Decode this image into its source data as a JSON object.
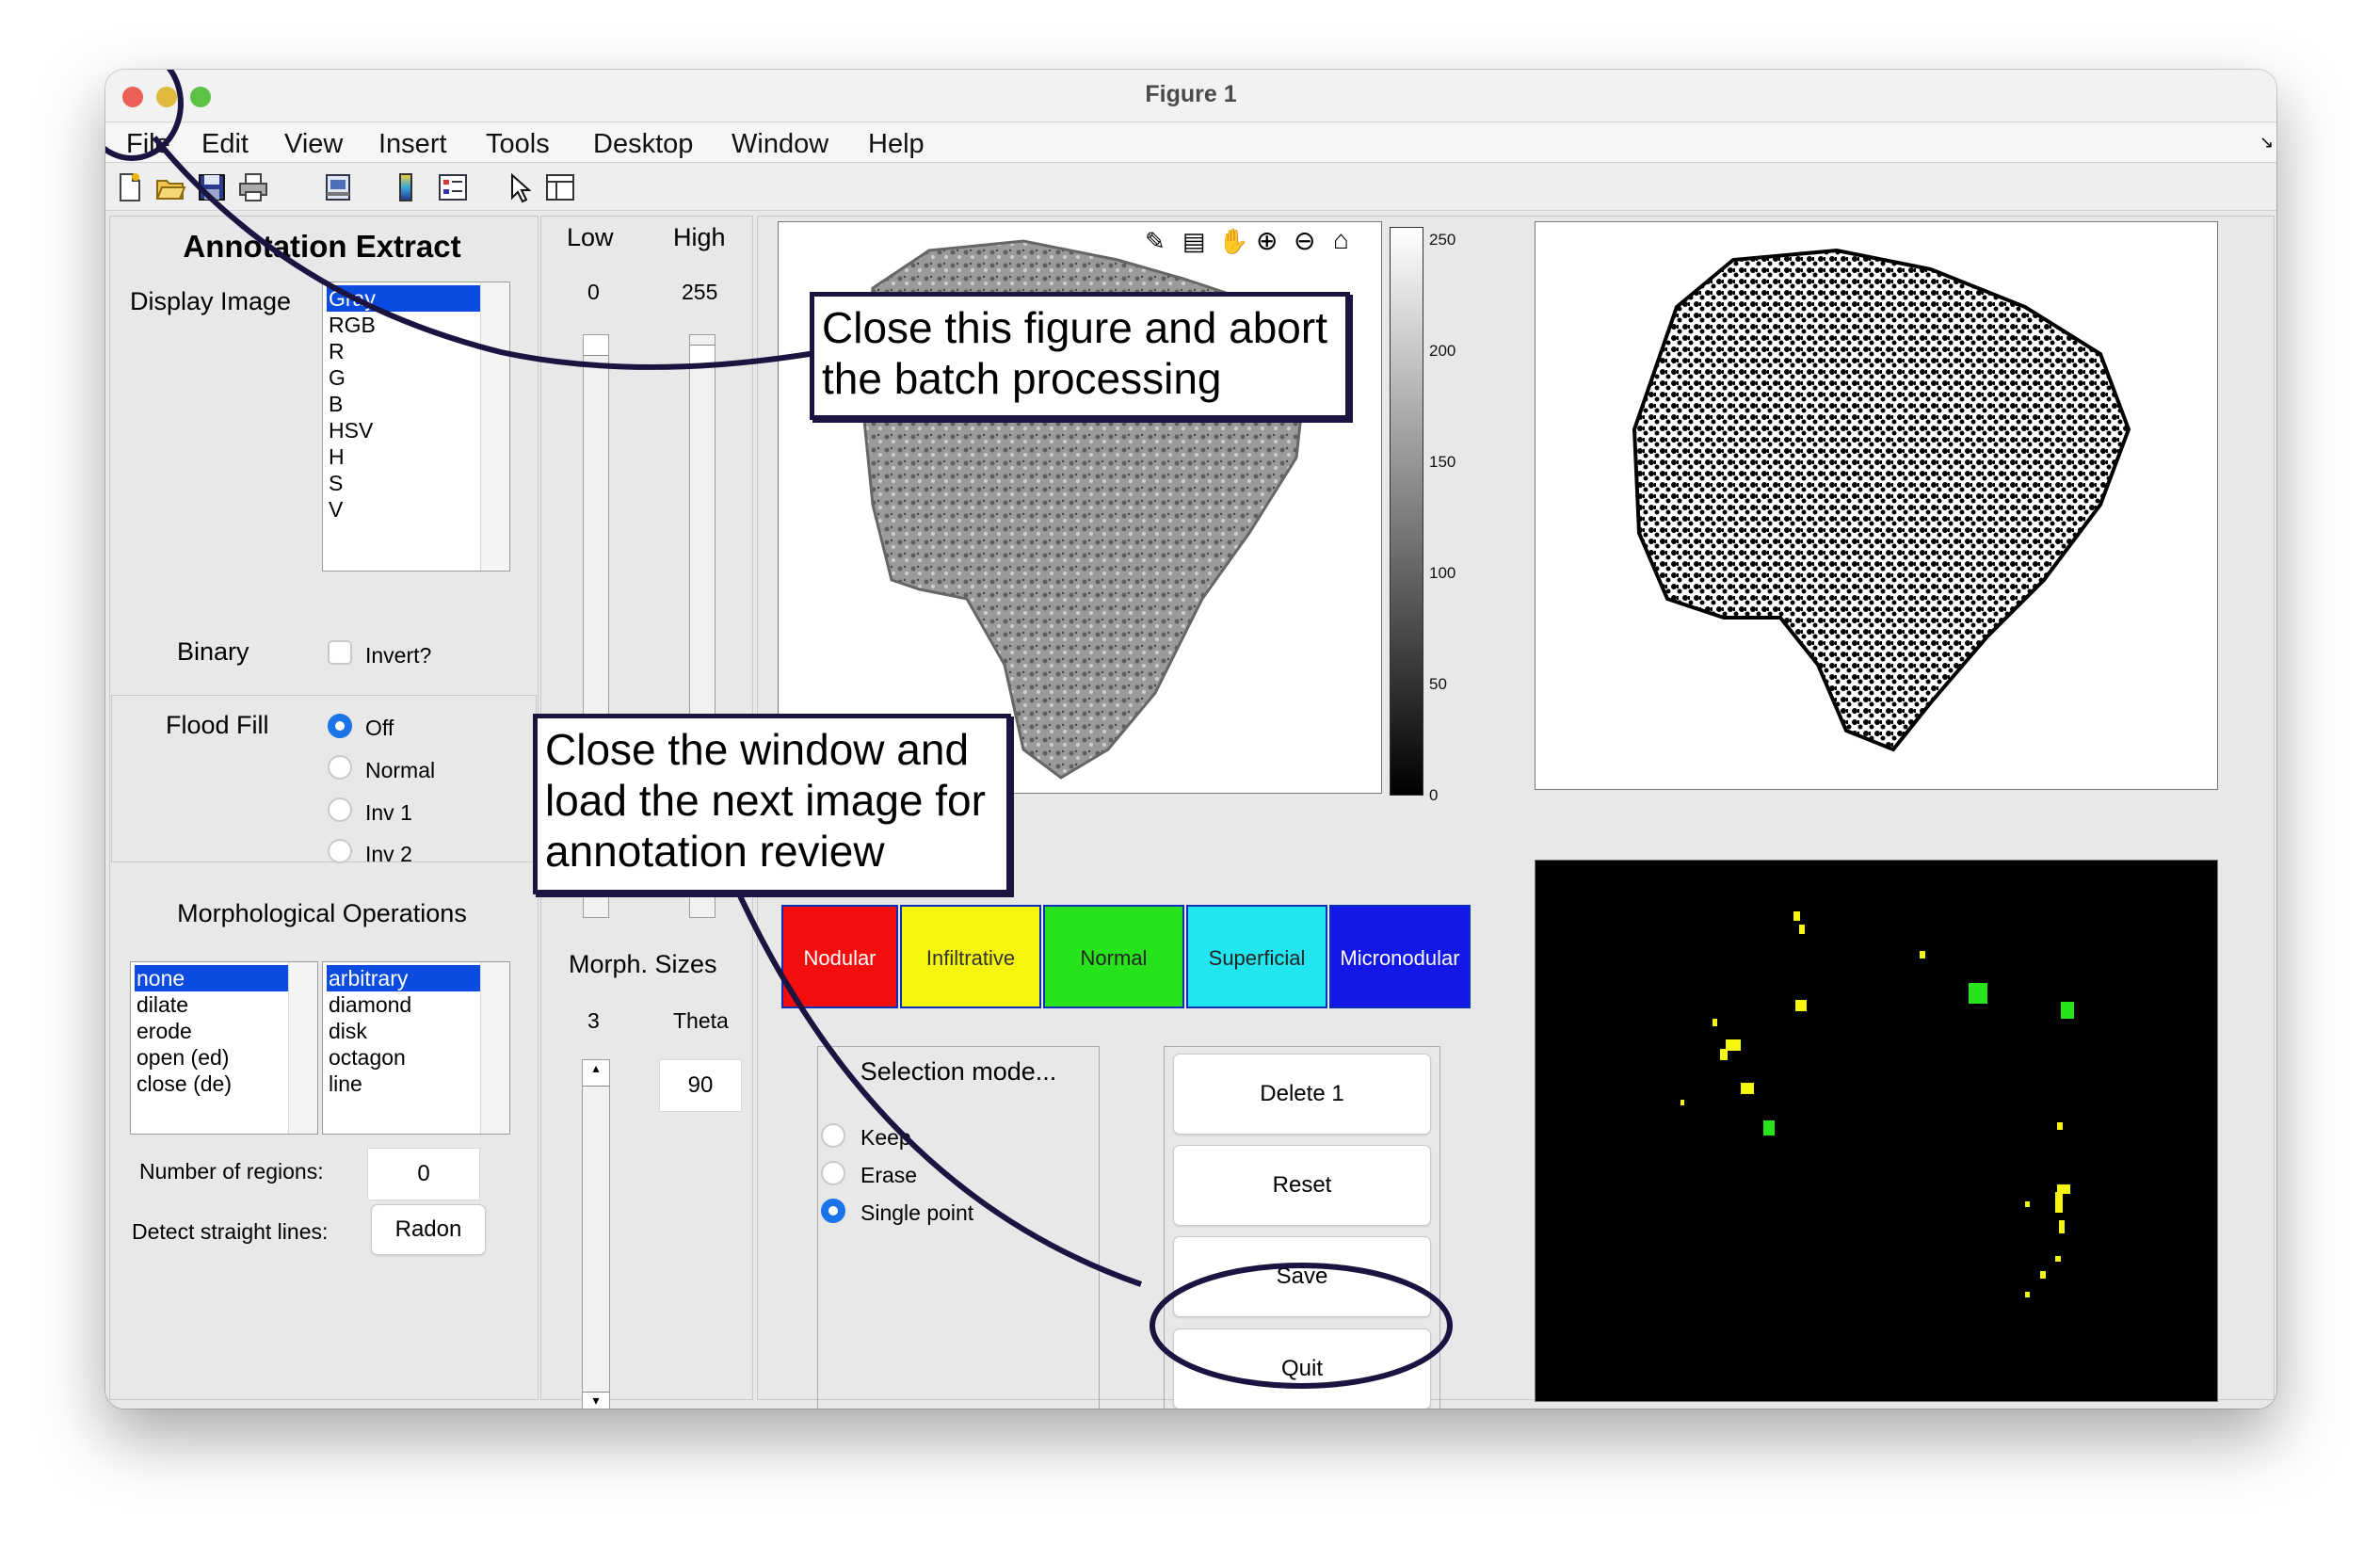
{
  "window": {
    "title": "Figure 1",
    "traffic_lights": {
      "close": "#ec5f57",
      "minimize": "#e0b93e",
      "maximize": "#5cc147"
    }
  },
  "menu": [
    "File",
    "Edit",
    "View",
    "Insert",
    "Tools",
    "Desktop",
    "Window",
    "Help"
  ],
  "toolbar": [
    "new-figure-icon",
    "open-file-icon",
    "save-icon",
    "print-icon",
    "print-preview-icon",
    "colorbar-icon",
    "legend-icon",
    "pointer-icon",
    "property-inspector-icon"
  ],
  "left_panel": {
    "title": "Annotation Extract",
    "display_image_label": "Display Image",
    "display_image_options": [
      "Gray",
      "RGB",
      "R",
      "G",
      "B",
      "HSV",
      "H",
      "S",
      "V"
    ],
    "display_image_selected": "Gray",
    "binary_label": "Binary",
    "invert_label": "Invert?",
    "flood_fill_label": "Flood Fill",
    "flood_fill_options": [
      "Off",
      "Normal",
      "Inv 1",
      "Inv 2"
    ],
    "flood_fill_selected": "Off",
    "morph_title": "Morphological Operations",
    "morph_ops": [
      "none",
      "dilate",
      "erode",
      "open (ed)",
      "close (de)"
    ],
    "morph_ops_selected": "none",
    "morph_shapes": [
      "arbitrary",
      "diamond",
      "disk",
      "octagon",
      "line"
    ],
    "morph_shapes_selected": "arbitrary",
    "num_regions_label": "Number of regions:",
    "num_regions_value": "0",
    "detect_lines_label": "Detect straight lines:",
    "radon_label": "Radon"
  },
  "threshold": {
    "low_label": "Low",
    "high_label": "High",
    "low_value": "0",
    "high_value": "255",
    "morph_sizes_label": "Morph. Sizes",
    "size_value": "3",
    "theta_label": "Theta",
    "theta_value": "90"
  },
  "colorbar": {
    "ticks": [
      "250",
      "200",
      "150",
      "100",
      "50",
      "0"
    ]
  },
  "categories": [
    {
      "label": "Nodular",
      "color": "#f30d0d"
    },
    {
      "label": "Infiltrative",
      "color": "#f5f50d"
    },
    {
      "label": "Normal",
      "color": "#27e31b"
    },
    {
      "label": "Superficial",
      "color": "#21e6ef"
    },
    {
      "label": "Micronodular",
      "color": "#1318e8"
    }
  ],
  "selection": {
    "title": "Selection mode...",
    "options": [
      "Keep",
      "Erase",
      "Single point"
    ],
    "selected": "Single point"
  },
  "actions": {
    "delete_label": "Delete 1",
    "reset_label": "Reset",
    "save_label": "Save",
    "quit_label": "Quit"
  },
  "annotations": {
    "callout_1": "Close this figure and abort the batch processing",
    "callout_2": "Close the window and load the next image for annotation review"
  }
}
